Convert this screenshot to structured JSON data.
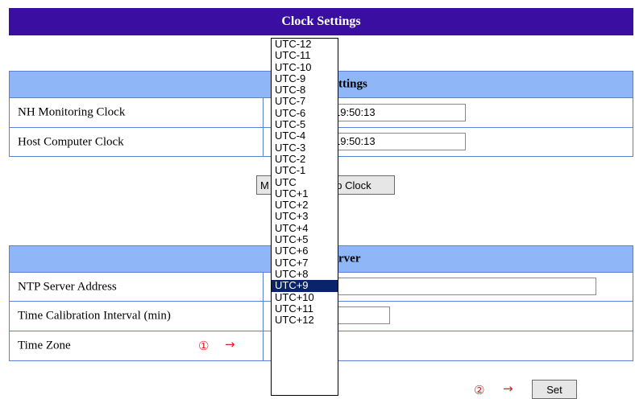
{
  "page": {
    "title": "Clock Settings"
  },
  "clock_section": {
    "header_visible": "ttings",
    "rows": [
      {
        "label": "NH Monitoring Clock",
        "value_visible": "19:50:13"
      },
      {
        "label": "Host Computer Clock",
        "value_visible": "19:50:13"
      }
    ],
    "button_left_visible": "M",
    "button_right_visible": "up Clock"
  },
  "ntp_section": {
    "header_visible": "rver",
    "rows": [
      {
        "label": "NTP Server Address",
        "value": ""
      },
      {
        "label": "Time Calibration Interval (min)",
        "value": ""
      },
      {
        "label": "Time Zone",
        "selected": "UTC+9"
      }
    ]
  },
  "markers": {
    "m1": "①",
    "m2": "②",
    "arrow": "→"
  },
  "set_button": {
    "label": "Set"
  },
  "timezone_dropdown": {
    "selected_index": 21,
    "options": [
      "UTC-12",
      "UTC-11",
      "UTC-10",
      "UTC-9",
      "UTC-8",
      "UTC-7",
      "UTC-6",
      "UTC-5",
      "UTC-4",
      "UTC-3",
      "UTC-2",
      "UTC-1",
      "UTC",
      "UTC+1",
      "UTC+2",
      "UTC+3",
      "UTC+4",
      "UTC+5",
      "UTC+6",
      "UTC+7",
      "UTC+8",
      "UTC+9",
      "UTC+10",
      "UTC+11",
      "UTC+12"
    ]
  },
  "colors": {
    "title_bg": "#3a0ea0",
    "header_bg": "#8fb6f7",
    "border": "#5b7fd6",
    "selection": "#0a246a",
    "marker": "#e02020"
  }
}
